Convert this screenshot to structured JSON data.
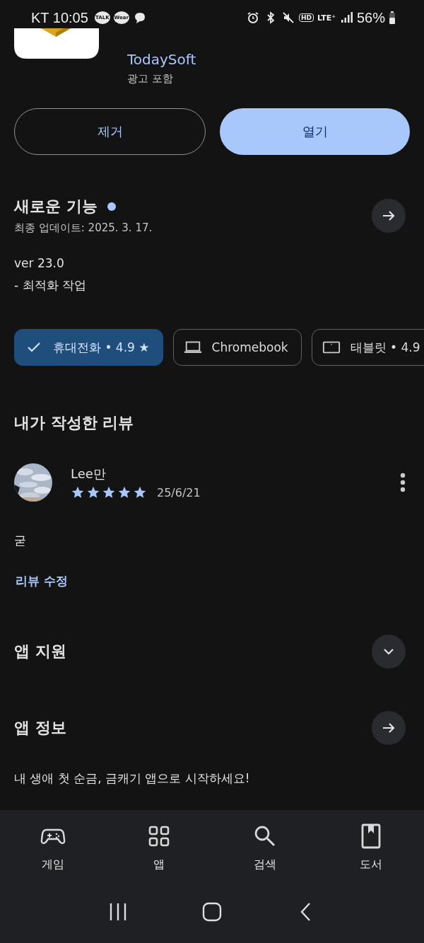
{
  "status_bar": {
    "carrier_time": "KT 10:05",
    "notification_badges": [
      "TALK",
      "Wear"
    ],
    "network_badges": [
      "HD",
      "LTE⁺"
    ],
    "battery": "56%"
  },
  "app": {
    "developer": "TodaySoft",
    "ad_note": "광고 포함"
  },
  "buttons": [
    {
      "label": "제거",
      "kind": "outlined"
    },
    {
      "label": "열기",
      "kind": "filled"
    }
  ],
  "whats_new": {
    "title": "새로운 기능",
    "updated": "최종 업데이트: 2025. 3. 17.",
    "version": "ver 23.0",
    "notes": "- 최적화 작업"
  },
  "devices": [
    {
      "label": "휴대전화 • 4.9 ★",
      "selected": true
    },
    {
      "label": "Chromebook",
      "kind": "laptop",
      "selected": false
    },
    {
      "label": "태블릿 • 4.9",
      "kind": "tablet",
      "selected": false
    }
  ],
  "my_review": {
    "title": "내가 작성한 리뷰",
    "author": "Lee만",
    "stars": 5,
    "date": "25/6/21",
    "text": "굳",
    "edit_link": "리뷰 수정"
  },
  "sections": [
    {
      "title": "앱 지원",
      "kind": "expand"
    },
    {
      "title": "앱 정보",
      "kind": "arrow",
      "description": "내 생애 첫 순금, 금캐기 앱으로 시작하세요!"
    }
  ],
  "bottom_nav": [
    {
      "label": "게임",
      "kind": "games"
    },
    {
      "label": "앱",
      "kind": "apps"
    },
    {
      "label": "검색",
      "kind": "search"
    },
    {
      "label": "도서",
      "kind": "books"
    }
  ]
}
